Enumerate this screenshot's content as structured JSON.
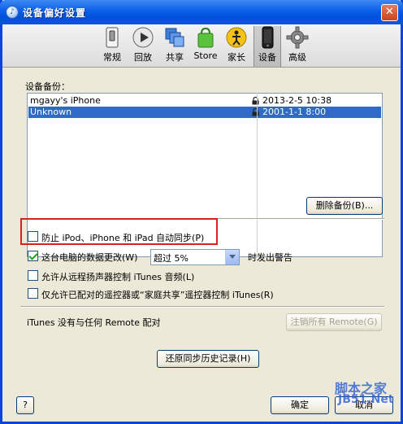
{
  "window": {
    "title": "设备偏好设置"
  },
  "toolbar": {
    "items": [
      {
        "label": "常规",
        "icon": "switch-icon"
      },
      {
        "label": "回放",
        "icon": "play-icon"
      },
      {
        "label": "共享",
        "icon": "share-icon"
      },
      {
        "label": "Store",
        "icon": "store-bag-icon"
      },
      {
        "label": "家长",
        "icon": "parental-icon"
      },
      {
        "label": "设备",
        "icon": "device-icon",
        "active": true
      },
      {
        "label": "高级",
        "icon": "gear-icon"
      }
    ]
  },
  "backups": {
    "label": "设备备份：",
    "rows": [
      {
        "name": "mgayy's iPhone",
        "date": "2013-2-5 10:38"
      },
      {
        "name": "Unknown",
        "date": "2001-1-1 8:00",
        "selected": true
      }
    ],
    "delete_button": "删除备份(B)..."
  },
  "options": {
    "prevent_sync": {
      "label": "防止 iPod、iPhone 和 iPad 自动同步(P)",
      "checked": false
    },
    "data_change": {
      "label": "这台电脑的数据更改(W)",
      "checked": true,
      "select_value": "超过 5%",
      "suffix": "时发出警告"
    },
    "allow_remote_speakers": {
      "label": "允许从远程扬声器控制 iTunes 音频(L)",
      "checked": false
    },
    "only_paired_remotes": {
      "label": "仅允许已配对的遥控器或“家庭共享”遥控器控制 iTunes(R)",
      "checked": false
    }
  },
  "remote": {
    "status": "iTunes 没有与任何 Remote 配对",
    "deauthorize_button": "注销所有 Remote(G)"
  },
  "reset_history_button": "还原同步历史记录(H)",
  "footer": {
    "help": "?",
    "ok": "确定",
    "cancel": "取消"
  },
  "watermark": {
    "site": "脚本之家",
    "url": "JB51.Net"
  }
}
